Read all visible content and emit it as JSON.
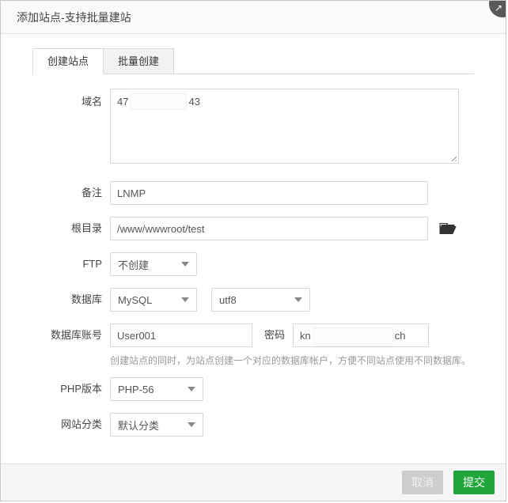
{
  "dialog": {
    "title": "添加站点-支持批量建站",
    "corner_arrow_glyph": "↗"
  },
  "tabs": {
    "create_site": "创建站点",
    "batch_create": "批量创建"
  },
  "form": {
    "domain": {
      "label": "域名",
      "value_prefix": "47",
      "value_suffix": "43",
      "redacted": true
    },
    "note": {
      "label": "备注",
      "value": "LNMP"
    },
    "root_dir": {
      "label": "根目录",
      "value": "/www/wwwroot/test",
      "icon": "open-folder-icon"
    },
    "ftp": {
      "label": "FTP",
      "selected": "不创建"
    },
    "database": {
      "label": "数据库",
      "type_selected": "MySQL",
      "charset_selected": "utf8"
    },
    "db_account": {
      "label": "数据库账号",
      "value": "User001"
    },
    "db_password": {
      "label": "密码",
      "value_prefix": "kn",
      "value_suffix": "ch",
      "redacted": true
    },
    "db_help": "创建站点的同时，为站点创建一个对应的数据库帐户，方便不同站点使用不同数据库。",
    "php_version": {
      "label": "PHP版本",
      "selected": "PHP-56"
    },
    "site_category": {
      "label": "网站分类",
      "selected": "默认分类"
    }
  },
  "footer": {
    "cancel_label": "取消",
    "submit_label": "提交"
  },
  "colors": {
    "accent_green": "#20a53a",
    "border": "#d9d9d9",
    "label_text": "#444444",
    "muted_text": "#999999"
  }
}
